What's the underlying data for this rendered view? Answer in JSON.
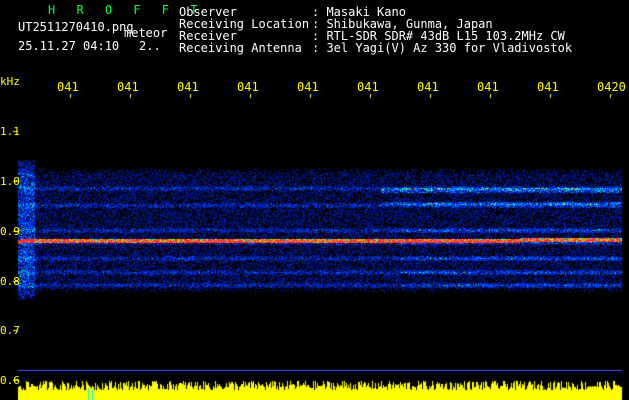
{
  "header": {
    "program": "H R O F F T",
    "filename": "UT2511270410.png",
    "mode": "meteor",
    "datetime": "25.11.27 04:10",
    "extra": "2..",
    "fields": [
      {
        "label": "Observer",
        "value": ": Masaki Kano"
      },
      {
        "label": "Receiving Location",
        "value": ": Shibukawa, Gunma, Japan"
      },
      {
        "label": "Receiver",
        "value": ": RTL-SDR SDR# 43dB L15 103.2MHz CW"
      },
      {
        "label": "Receiving Antenna",
        "value": ": 3el Yagi(V) Az 330 for Vladivostok"
      }
    ]
  },
  "axes": {
    "y_unit": "kHz",
    "y_ticks": [
      "1.1",
      "1.0",
      "0.9",
      "0.8",
      "0.7",
      "0.6"
    ],
    "x_ticks": [
      "041",
      "041",
      "041",
      "041",
      "041",
      "041",
      "041",
      "041",
      "041",
      "0420"
    ]
  },
  "colors": {
    "text": "#ffffff",
    "axis": "#ffff00",
    "title": "#00ff40",
    "background": "#000000"
  }
}
